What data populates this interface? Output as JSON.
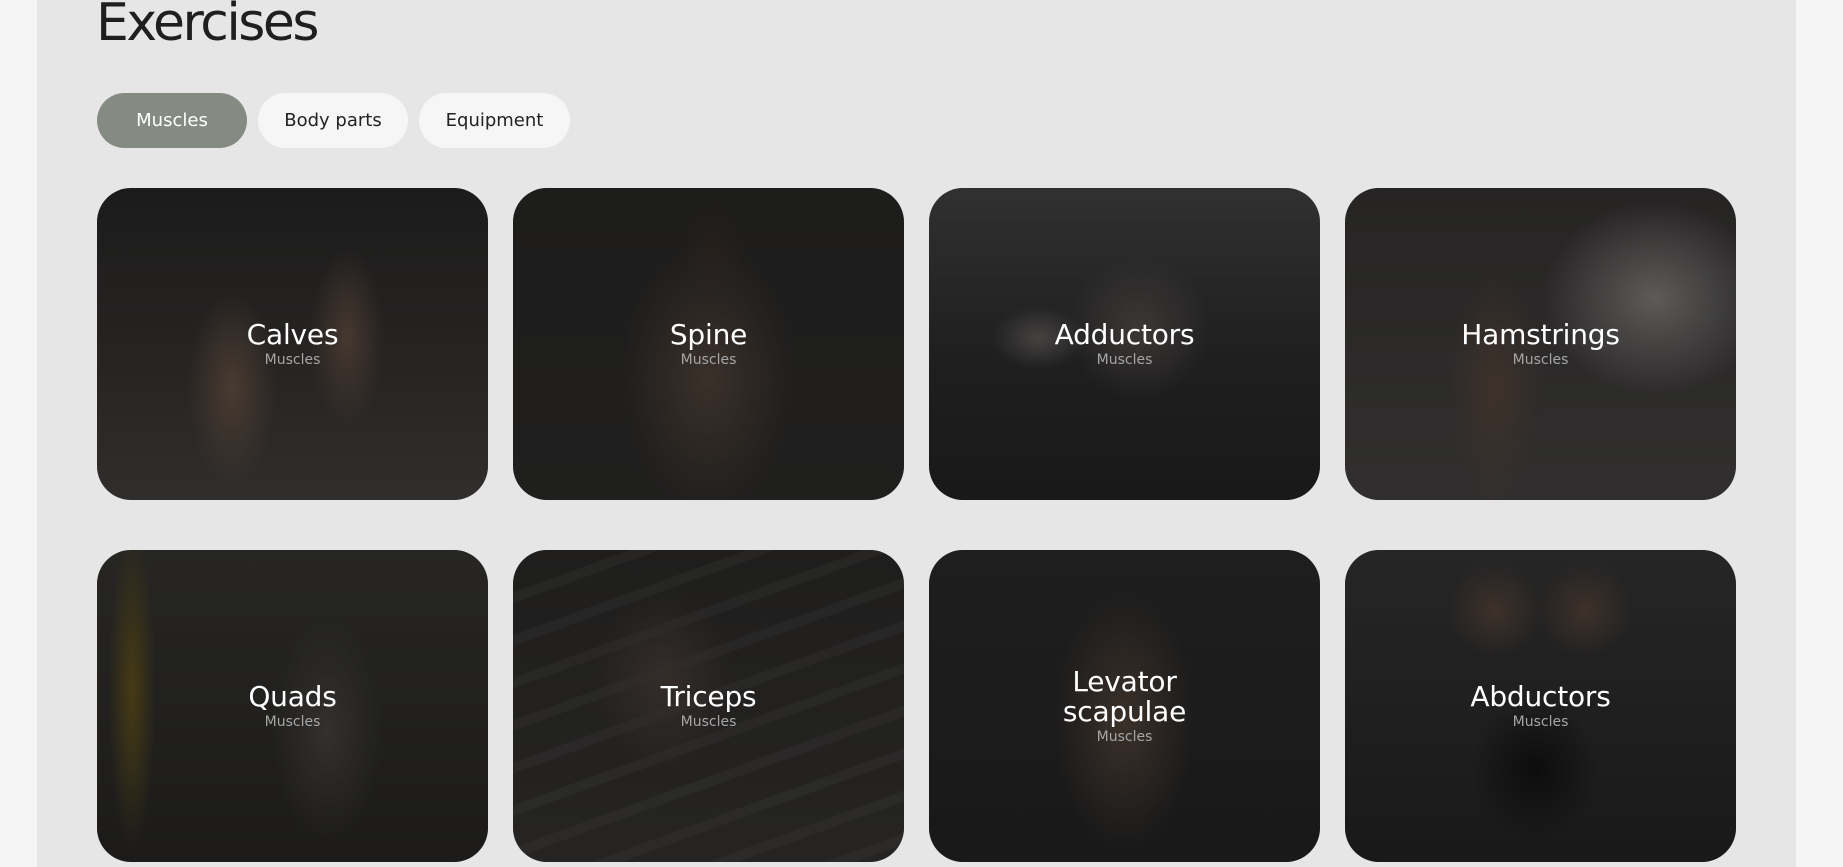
{
  "page": {
    "title": "Exercises"
  },
  "tabs": [
    {
      "label": "Muscles",
      "active": true
    },
    {
      "label": "Body parts",
      "active": false
    },
    {
      "label": "Equipment",
      "active": false
    }
  ],
  "cards": [
    {
      "title": "Calves",
      "subtitle": "Muscles"
    },
    {
      "title": "Spine",
      "subtitle": "Muscles"
    },
    {
      "title": "Adductors",
      "subtitle": "Muscles"
    },
    {
      "title": "Hamstrings",
      "subtitle": "Muscles"
    },
    {
      "title": "Quads",
      "subtitle": "Muscles"
    },
    {
      "title": "Triceps",
      "subtitle": "Muscles"
    },
    {
      "title_line1": "Levator",
      "title_line2": "scapulae",
      "subtitle": "Muscles"
    },
    {
      "title": "Abductors",
      "subtitle": "Muscles"
    }
  ],
  "colors": {
    "page_bg": "#f5f5f5",
    "panel_bg": "#e6e6e6",
    "active_tab": "#858a83",
    "inactive_tab": "#f6f6f6"
  }
}
